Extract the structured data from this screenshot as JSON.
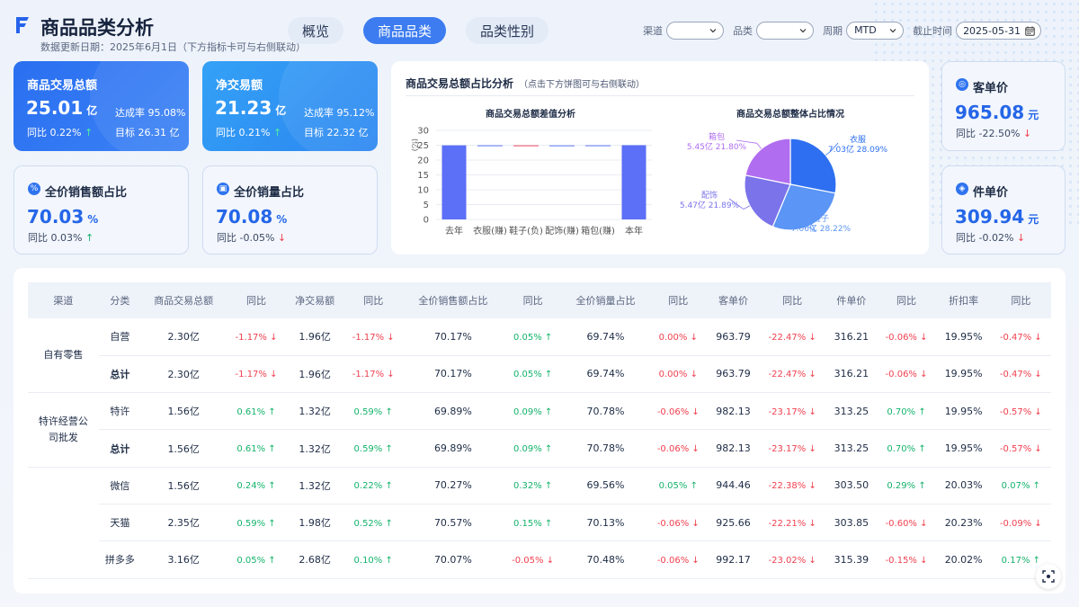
{
  "header": {
    "title": "商品品类分析",
    "subtitle": "数据更新日期：2025年6月1日（下方指标卡可与右侧联动）",
    "tabs": [
      {
        "label": "概览",
        "active": false
      },
      {
        "label": "商品品类",
        "active": true
      },
      {
        "label": "品类性别",
        "active": false
      }
    ],
    "filters": {
      "channel_label": "渠道",
      "channel_value": "",
      "category_label": "品类",
      "category_value": "",
      "period_label": "周期",
      "period_value": "MTD",
      "cutoff_label": "截止时间",
      "cutoff_value": "2025-05-31"
    }
  },
  "kpi": {
    "gmv": {
      "title": "商品交易总额",
      "value": "25.01",
      "unit": "亿",
      "rate_label": "达成率",
      "rate": "95.08%",
      "yoy_label": "同比",
      "yoy": "0.22%",
      "target_label": "目标",
      "target": "26.31 亿"
    },
    "net": {
      "title": "净交易额",
      "value": "21.23",
      "unit": "亿",
      "rate_label": "达成率",
      "rate": "95.12%",
      "yoy_label": "同比",
      "yoy": "0.21%",
      "target_label": "目标",
      "target": "22.32 亿"
    },
    "full_sales": {
      "title": "全价销售额占比",
      "value": "70.03",
      "unit": "%",
      "yoy_label": "同比",
      "yoy": "0.03%"
    },
    "full_qty": {
      "title": "全价销量占比",
      "value": "70.08",
      "unit": "%",
      "yoy_label": "同比",
      "yoy": "-0.05%"
    },
    "aov": {
      "title": "客单价",
      "value": "965.08",
      "unit": "元",
      "yoy_label": "同比",
      "yoy": "-22.50%"
    },
    "upt": {
      "title": "件单价",
      "value": "309.94",
      "unit": "元",
      "yoy_label": "同比",
      "yoy": "-0.02%"
    }
  },
  "panel": {
    "title": "商品交易总额占比分析",
    "hint": "（点击下方饼图可与右侧联动）"
  },
  "chart_data": [
    {
      "type": "bar",
      "title": "商品交易总额差值分析",
      "ylabel": "亿",
      "ylim": [
        0,
        30
      ],
      "yticks": [
        0,
        5,
        10,
        15,
        20,
        25,
        30
      ],
      "categories": [
        "去年",
        "衣服(赚)",
        "鞋子(负)",
        "配饰(赚)",
        "箱包(赚)",
        "本年"
      ],
      "values": [
        24.96,
        0.03,
        -0.04,
        0.02,
        0.04,
        25.01
      ],
      "colors": [
        "#5b6ff7",
        "#7b8ff7",
        "#f06a7a",
        "#7b8ff7",
        "#7b8ff7",
        "#5b6ff7"
      ]
    },
    {
      "type": "pie",
      "title": "商品交易总额整体占比情况",
      "slices": [
        {
          "name": "衣服",
          "amount": "7.03亿",
          "percent": 28.09,
          "color": "#2d6ff0"
        },
        {
          "name": "鞋子",
          "amount": "7.06亿",
          "percent": 28.22,
          "color": "#5b95f5"
        },
        {
          "name": "配饰",
          "amount": "5.47亿",
          "percent": 21.89,
          "color": "#7a73ea"
        },
        {
          "name": "箱包",
          "amount": "5.45亿",
          "percent": 21.8,
          "color": "#b06df0"
        }
      ]
    }
  ],
  "table": {
    "headers": [
      "渠道",
      "分类",
      "商品交易总额",
      "同比",
      "净交易额",
      "同比",
      "全价销售额占比",
      "同比",
      "全价销量占比",
      "同比",
      "客单价",
      "同比",
      "件单价",
      "同比",
      "折扣率",
      "同比"
    ],
    "groups": [
      {
        "channel": "自有零售",
        "rows": [
          {
            "cat": "自营",
            "bold": false,
            "v": [
              "2.30亿",
              "-1.17%",
              "1.96亿",
              "-1.17%",
              "70.17%",
              "0.05%",
              "69.74%",
              "0.00%",
              "963.79",
              "-22.47%",
              "316.21",
              "-0.06%",
              "19.95%",
              "-0.47%"
            ]
          },
          {
            "cat": "总计",
            "bold": true,
            "v": [
              "2.30亿",
              "-1.17%",
              "1.96亿",
              "-1.17%",
              "70.17%",
              "0.05%",
              "69.74%",
              "0.00%",
              "963.79",
              "-22.47%",
              "316.21",
              "-0.06%",
              "19.95%",
              "-0.47%"
            ]
          }
        ]
      },
      {
        "channel": "特许经营公司批发",
        "rows": [
          {
            "cat": "特许",
            "bold": false,
            "v": [
              "1.56亿",
              "0.61%",
              "1.32亿",
              "0.59%",
              "69.89%",
              "0.09%",
              "70.78%",
              "-0.06%",
              "982.13",
              "-23.17%",
              "313.25",
              "0.70%",
              "19.95%",
              "-0.57%"
            ]
          },
          {
            "cat": "总计",
            "bold": true,
            "v": [
              "1.56亿",
              "0.61%",
              "1.32亿",
              "0.59%",
              "69.89%",
              "0.09%",
              "70.78%",
              "-0.06%",
              "982.13",
              "-23.17%",
              "313.25",
              "0.70%",
              "19.95%",
              "-0.57%"
            ]
          }
        ]
      },
      {
        "channel": "",
        "rows": [
          {
            "cat": "微信",
            "bold": false,
            "v": [
              "1.56亿",
              "0.24%",
              "1.32亿",
              "0.22%",
              "70.27%",
              "0.32%",
              "69.56%",
              "0.05%",
              "944.46",
              "-22.38%",
              "303.50",
              "0.29%",
              "20.03%",
              "0.07%"
            ]
          },
          {
            "cat": "天猫",
            "bold": false,
            "v": [
              "2.35亿",
              "0.59%",
              "1.98亿",
              "0.52%",
              "70.57%",
              "0.15%",
              "70.13%",
              "-0.06%",
              "925.66",
              "-22.21%",
              "303.85",
              "-0.60%",
              "20.23%",
              "-0.09%"
            ]
          },
          {
            "cat": "拼多多",
            "bold": false,
            "v": [
              "3.16亿",
              "0.05%",
              "2.68亿",
              "0.10%",
              "70.07%",
              "-0.05%",
              "70.48%",
              "-0.06%",
              "992.17",
              "-23.02%",
              "315.39",
              "-0.15%",
              "20.02%",
              "0.17%"
            ]
          }
        ]
      }
    ]
  },
  "icons": {
    "up": "arrow-up-icon",
    "down": "arrow-down-icon",
    "calendar": "calendar-icon",
    "fab": "focus-icon"
  }
}
